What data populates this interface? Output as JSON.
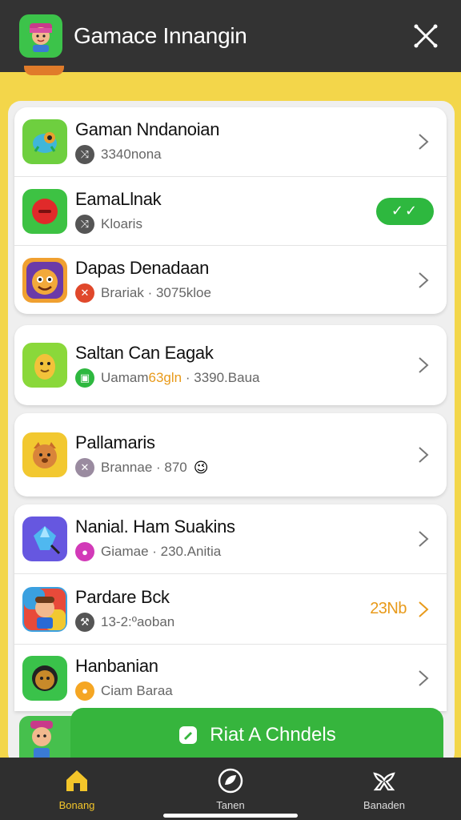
{
  "header": {
    "title": "Gamace Innangin",
    "icon": "avatar-app-icon",
    "close_icon": "close-icon"
  },
  "list": {
    "items": [
      {
        "title": "Gaman Nndanoian",
        "subtitle": "3340nona",
        "badge_icon": "shuffle-icon",
        "badge_color": "#555555",
        "icon_bg": "#6ecf3f",
        "action": "chevron"
      },
      {
        "title": "EamaLlnak",
        "subtitle": "Kloaris",
        "badge_icon": "shuffle-icon",
        "badge_color": "#555555",
        "icon_bg": "#3dc243",
        "action": "toggle",
        "toggle_label": "✓✓"
      },
      {
        "title": "Dapas Denadaan",
        "subtitle": "Brariak · 3075kloe",
        "badge_icon": "x-icon",
        "badge_color": "#e0482b",
        "icon_bg": "#f0a030",
        "action": "chevron"
      },
      {
        "title": "Saltan Can Eagak",
        "subtitle_part1": "Uamam",
        "subtitle_part2": "63gln",
        "subtitle_part3": "· 3390.Baua",
        "badge_icon": "grid-icon",
        "badge_color": "#2eb83f",
        "icon_bg": "#8ad83a",
        "action": "chevron"
      },
      {
        "title": "Pallamaris",
        "subtitle": "Brannae · 870",
        "badge_icon": "x-icon",
        "badge_color": "#9a8ba0",
        "icon_bg": "#f2c830",
        "action": "chevron"
      },
      {
        "title": "Nanial. Ham Suakins",
        "subtitle": "Giamae · 230.Anitia",
        "badge_icon": "circle-icon",
        "badge_color": "#d23ab8",
        "icon_bg": "#6657e0",
        "action": "chevron"
      },
      {
        "title": "Pardare Bck",
        "subtitle": "13-2:ºaoban",
        "badge_icon": "wrench-icon",
        "badge_color": "#555555",
        "icon_bg": "#3aa0e0",
        "action": "chevron",
        "extra": "23Nb"
      },
      {
        "title": "Hanbanian",
        "subtitle": "Ciam Baraa",
        "badge_icon": "circle-icon",
        "badge_color": "#f5a623",
        "icon_bg": "#3ac24a",
        "action": "chevron"
      }
    ]
  },
  "cta": {
    "label": "Riat A Chndels",
    "icon": "edit-icon"
  },
  "bottom_nav": [
    {
      "label": "Bonang",
      "icon": "home-icon",
      "active": true
    },
    {
      "label": "Tanen",
      "icon": "leaf-icon",
      "active": false
    },
    {
      "label": "Banaden",
      "icon": "bow-icon",
      "active": false
    }
  ],
  "colors": {
    "accent": "#36b53d",
    "background": "#f3d64a",
    "topbar": "#333333",
    "active_nav": "#f3c52a"
  }
}
